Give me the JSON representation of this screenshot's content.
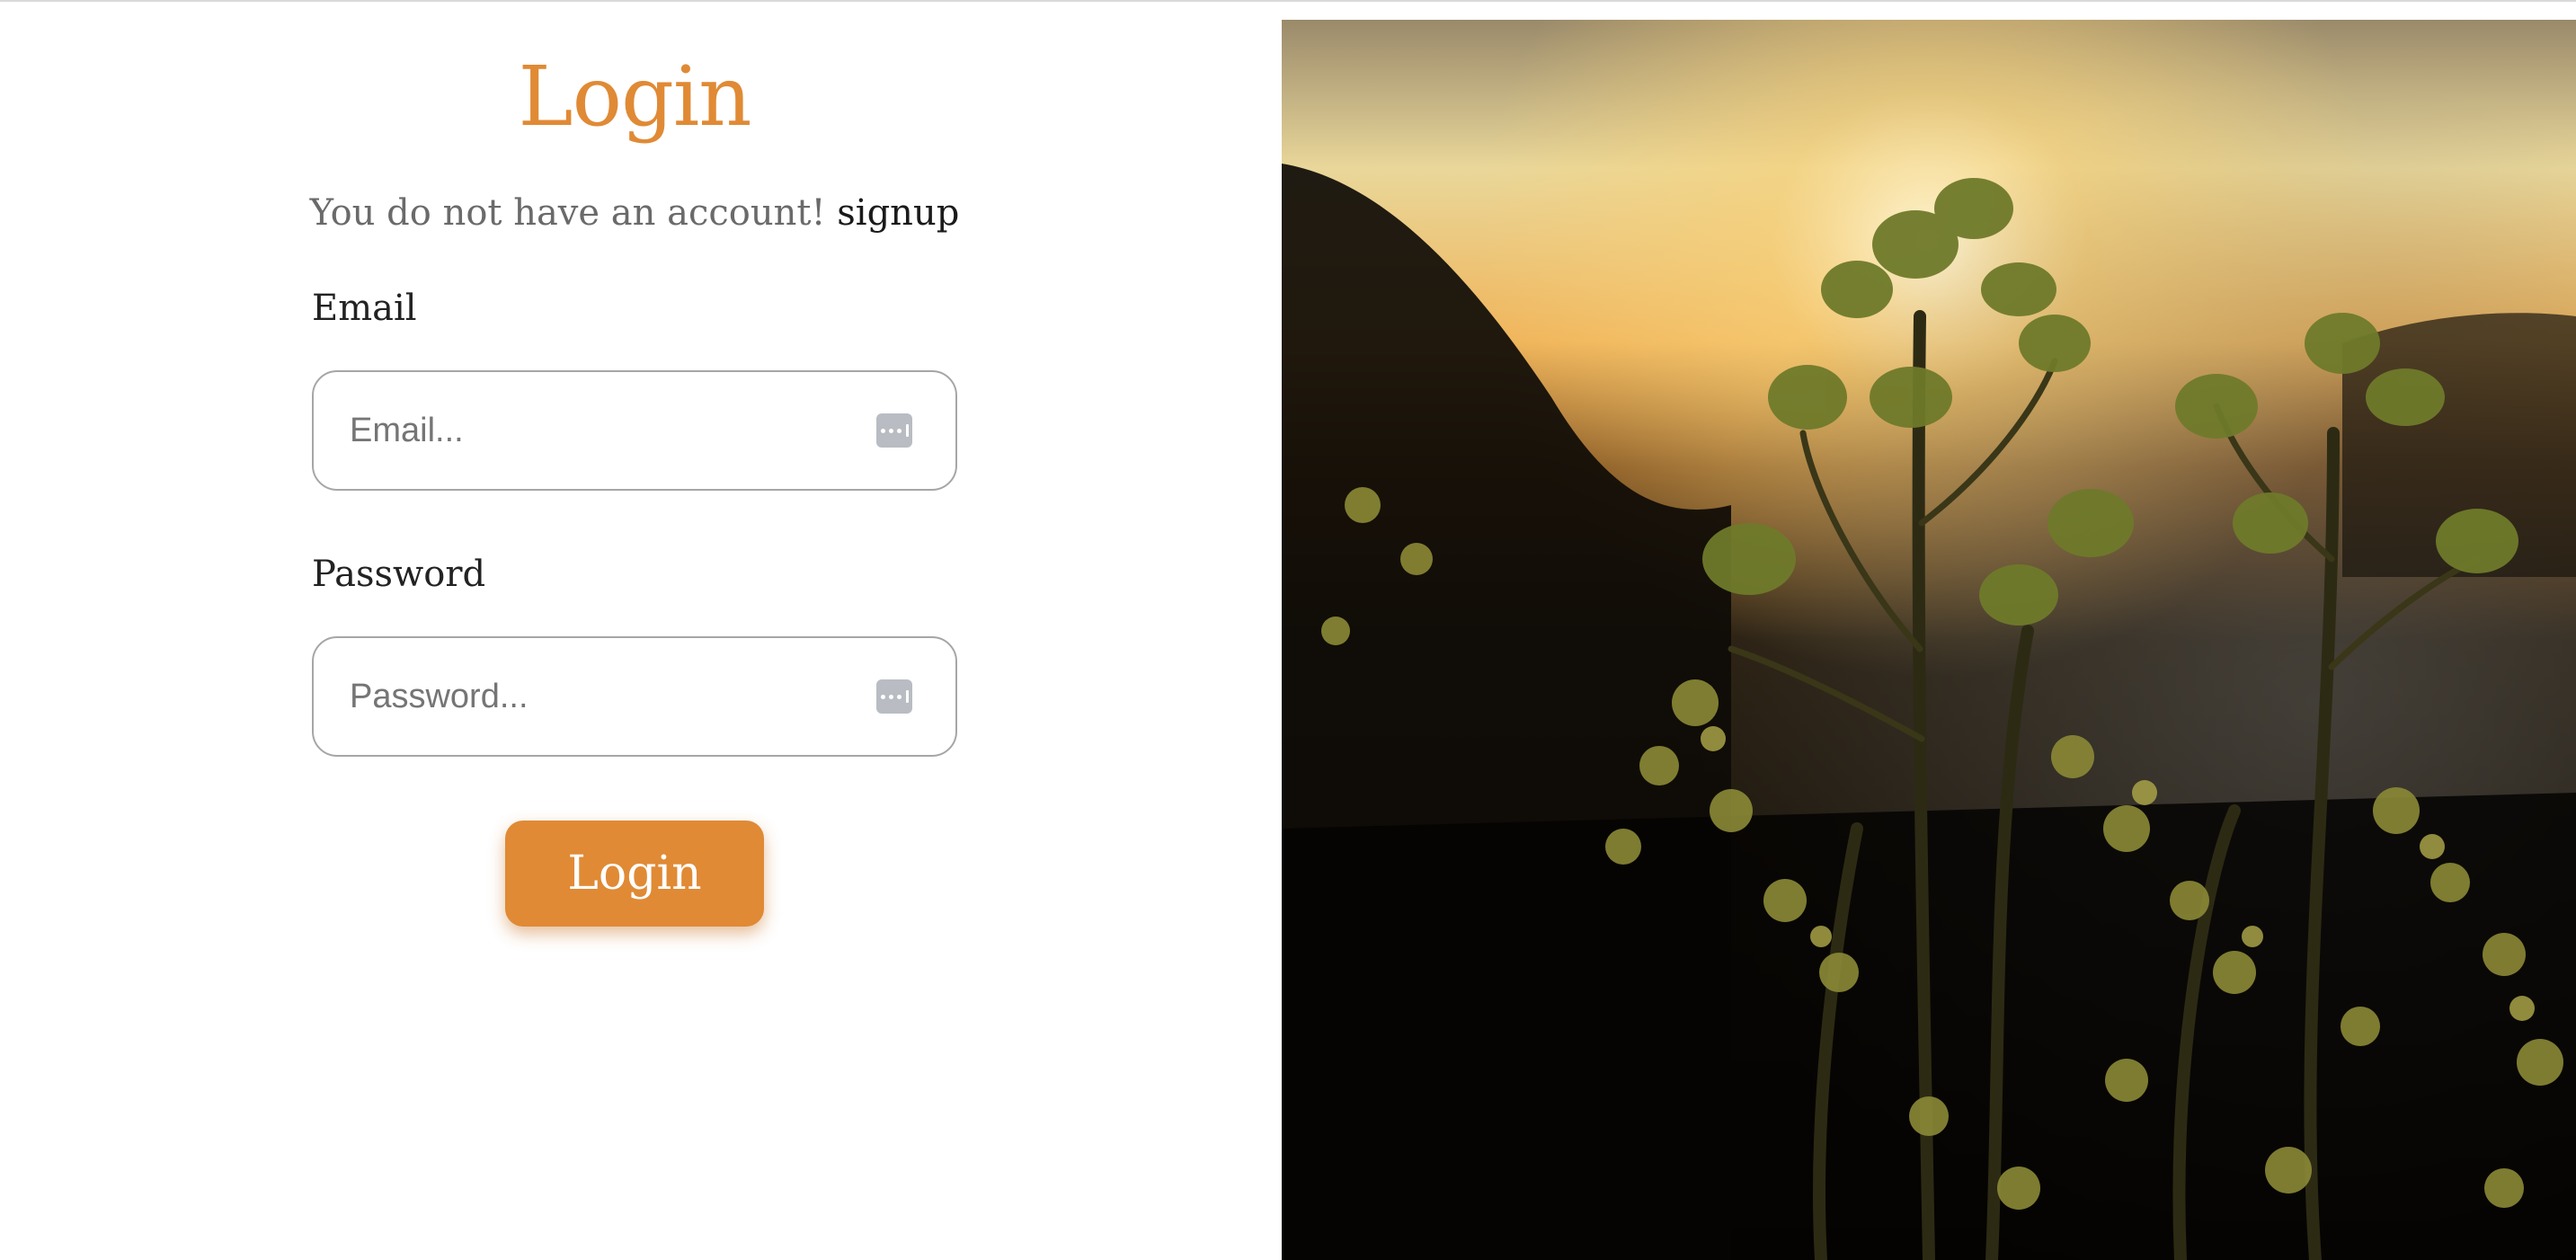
{
  "login": {
    "title": "Login",
    "signup_prompt": "You do not have an account!",
    "signup_link": "signup",
    "email": {
      "label": "Email",
      "placeholder": "Email..."
    },
    "password": {
      "label": "Password",
      "placeholder": "Password..."
    },
    "submit_label": "Login"
  },
  "icons": {
    "field_icon": "password-manager-key-icon"
  },
  "colors": {
    "accent": "#e08a35",
    "input_border": "#a6a6a6",
    "label_text": "#222222",
    "muted_text": "#6a6a6a"
  }
}
